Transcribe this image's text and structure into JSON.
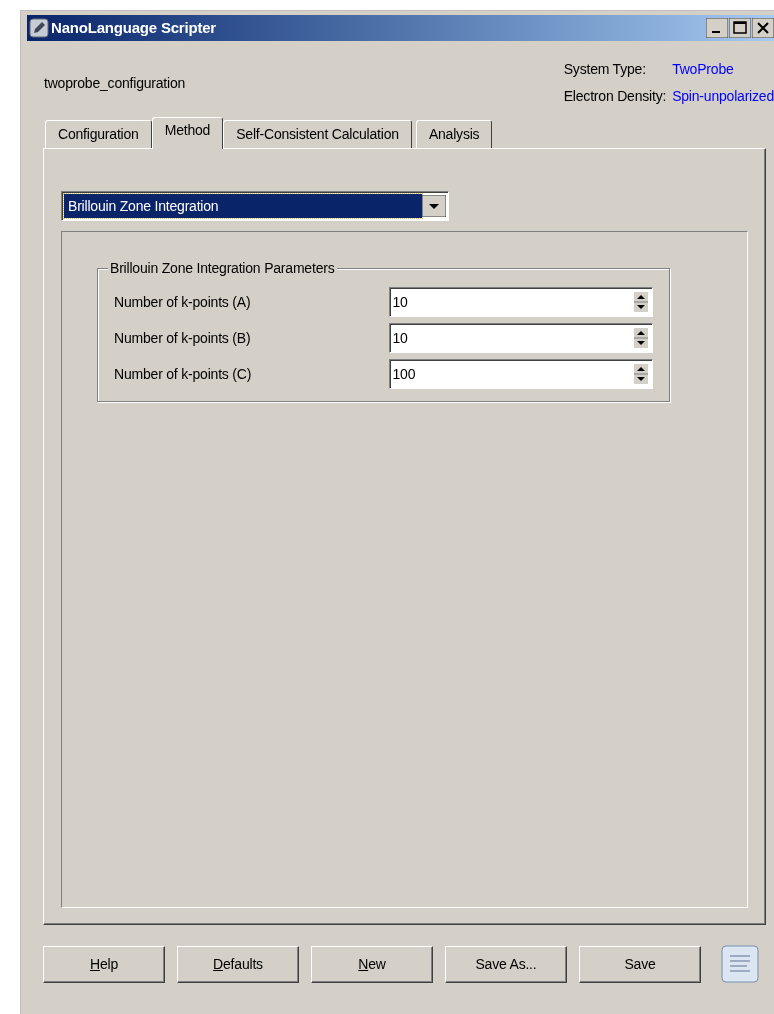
{
  "window": {
    "title": "NanoLanguage Scripter"
  },
  "header": {
    "name": "twoprobe_configuration",
    "info": [
      {
        "label": "System Type:",
        "value": "TwoProbe"
      },
      {
        "label": "Electron Density:",
        "value": "Spin-unpolarized"
      }
    ]
  },
  "tabs": [
    {
      "label": "Configuration",
      "selected": false
    },
    {
      "label": "Method",
      "selected": true
    },
    {
      "label": "Self-Consistent Calculation",
      "selected": false
    },
    {
      "label": "Analysis",
      "selected": false
    }
  ],
  "method_dropdown": {
    "value": "Brillouin Zone Integration"
  },
  "group": {
    "title": "Brillouin Zone Integration Parameters",
    "fields": [
      {
        "label": "Number of k-points (A)",
        "value": "10"
      },
      {
        "label": "Number of k-points (B)",
        "value": "10"
      },
      {
        "label": "Number of k-points (C)",
        "value": "100"
      }
    ]
  },
  "buttons": [
    {
      "key": "H",
      "rest": "elp"
    },
    {
      "key": "D",
      "rest": "efaults"
    },
    {
      "key": "N",
      "rest": "ew"
    },
    {
      "label": "Save As..."
    },
    {
      "label": "Save"
    }
  ]
}
